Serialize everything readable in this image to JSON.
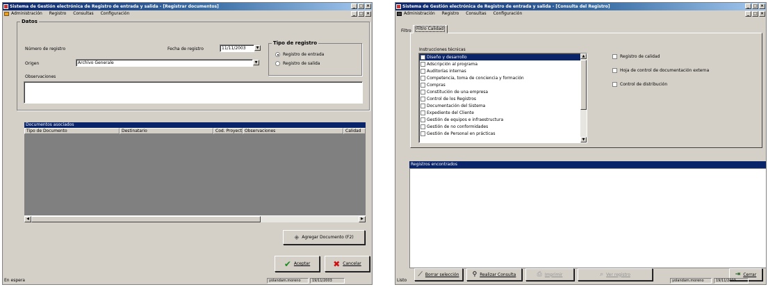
{
  "left_window": {
    "title": "Sistema de Gestión electrónica de Registro de entrada y salida - [Registrar documentos]",
    "menu": [
      "Administración",
      "Registro",
      "Consultas",
      "Configuración"
    ],
    "datos_group": "Datos",
    "numero_registro_label": "Número de registro",
    "fecha_registro_label": "Fecha de registro",
    "fecha_registro_value": "11/11/2003",
    "origen_label": "Origen",
    "origen_value": "Archivo Generale",
    "observaciones_label": "Observaciones",
    "tipo_registro_group": "Tipo de registro",
    "tipo_registro_options": [
      "Registro de entrada",
      "Registro de salida"
    ],
    "documentos_header": "Documentos asociados",
    "table_columns": [
      "Tipo de Documento",
      "Destinatario",
      "Cod. Proyecto",
      "Observaciones",
      "Calidad"
    ],
    "add_button": "Agregar Documento (F2)",
    "accept_button": "Aceptar",
    "cancel_button": "Cancelar",
    "status_left": "En espera",
    "status_user": "yolandam.moreno",
    "status_date": "19/11/2003"
  },
  "right_window": {
    "title": "Sistema de Gestión electrónica de Registro de entrada y salida - [Consulta del Registro]",
    "menu": [
      "Administración",
      "Registro",
      "Consultas",
      "Configuración"
    ],
    "tab_filtro": "Filtro",
    "tab_filtro_calidad": "Filtro Calidad",
    "instrucciones_label": "Instrucciones técnicas",
    "instrucciones_items": [
      "Diseño y desarrollo",
      "Adscripción al programa",
      "Auditorías internas",
      "Competencia, toma de conciencia y formación",
      "Compras",
      "Constitución de una empresa",
      "Control de los Registros",
      "Documentación del Sistema",
      "Expediente del Cliente",
      "Gestión de equipos e infraestructura",
      "Gestión de no conformidades",
      "Gestión de Personal en prácticas"
    ],
    "checkboxes": [
      "Registro de calidad",
      "Hoja de control de documentación externa",
      "Control de distribución"
    ],
    "registros_header": "Registros encontrados",
    "btn_borrar": "Borrar selección",
    "btn_realizar": "Realizar Consulta",
    "btn_imprimir": "Imprimir",
    "btn_ver": "Ver registro",
    "btn_cerrar": "Cerrar",
    "status_left": "Listo",
    "status_user": "yolandam.moreno",
    "status_date": "19/11/2003"
  }
}
